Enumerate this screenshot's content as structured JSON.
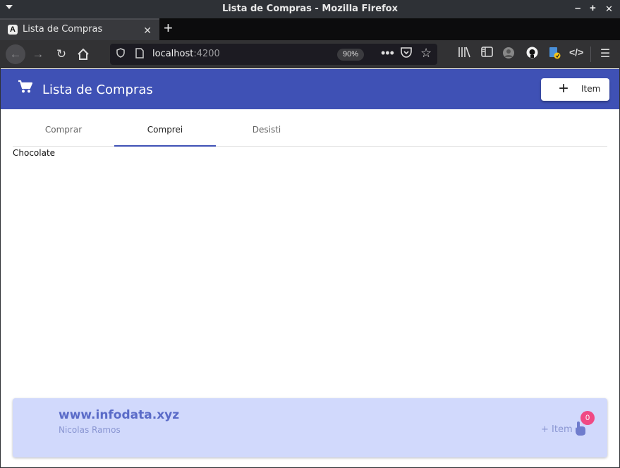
{
  "window": {
    "title": "Lista de Compras - Mozilla Firefox",
    "minimize": "–",
    "maximize": "+",
    "close": "✕"
  },
  "browser": {
    "tab": {
      "title": "Lista de Compras",
      "favicon": "A",
      "close": "✕"
    },
    "new_tab": "+",
    "url": {
      "host": "localhost",
      "port": ":4200"
    },
    "zoom": "90%",
    "icons": {
      "back": "arrow-left-icon",
      "forward": "arrow-right-icon",
      "reload": "reload-icon",
      "home": "home-icon",
      "shield": "tracking-shield-icon",
      "page": "page-info-icon",
      "more": "more-actions-icon",
      "pocket": "pocket-icon",
      "bookmark": "star-icon",
      "library": "library-icon",
      "sidebar": "sidebar-icon",
      "avatar": "account-avatar-icon",
      "github": "github-icon",
      "extension": "extension-icon",
      "devtools": "devtools-icon",
      "menu": "hamburger-menu-icon"
    }
  },
  "app": {
    "title": "Lista de Compras",
    "add_button": "Item",
    "accent_color": "#3f51b5",
    "tabs": [
      {
        "label": "Comprar"
      },
      {
        "label": "Comprei"
      },
      {
        "label": "Desisti"
      }
    ],
    "active_tab": "Comprei",
    "items": [
      "Chocolate"
    ]
  },
  "footer": {
    "site": "www.infodata.xyz",
    "author": "Nicolas Ramos",
    "add_item": "+ Item",
    "badge": "0",
    "background": "#d1d9fc",
    "badge_color": "#f04a84"
  }
}
